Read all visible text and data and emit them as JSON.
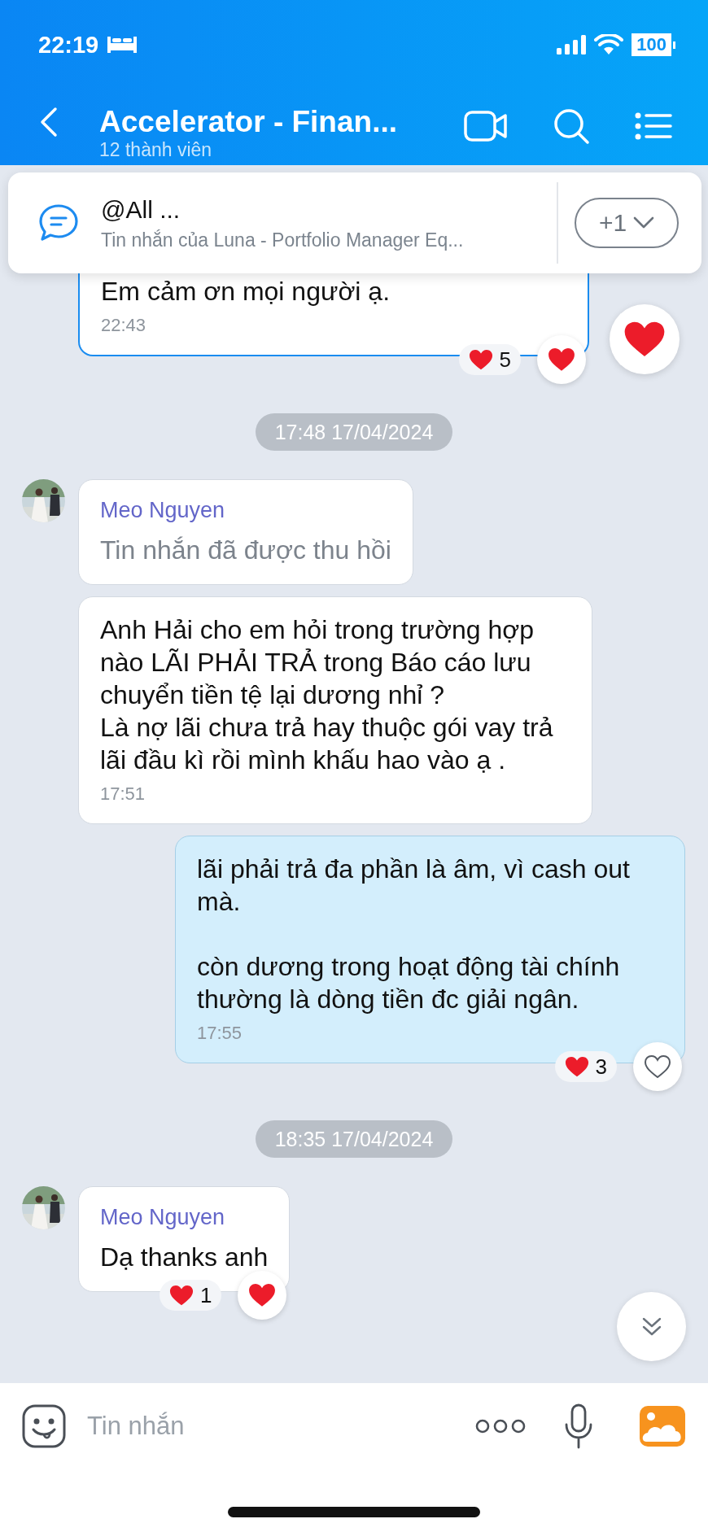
{
  "status_bar": {
    "time": "22:19",
    "battery": "100"
  },
  "header": {
    "title": "Accelerator - Finan...",
    "subtitle": "12 thành viên"
  },
  "pinned": {
    "title": "@All ...",
    "preview": "Tin nhắn của Luna - Portfolio Manager Eq...",
    "more": "+1"
  },
  "items": [
    {
      "kind": "received",
      "text": "Em cảm ơn mọi người ạ.",
      "time": "22:43",
      "recalled": false,
      "highlighted": true,
      "quick_react": true,
      "reactions": {
        "count": "5",
        "reacted": true
      }
    },
    {
      "kind": "date",
      "text": "17:48 17/04/2024"
    },
    {
      "kind": "received",
      "sender": "Meo Nguyen",
      "text": "Tin nhắn đã được thu hồi",
      "recalled": true,
      "highlighted": false,
      "quick_react": false
    },
    {
      "kind": "received",
      "text": "Anh Hải cho em hỏi trong trường hợp nào LÃI PHẢI TRẢ trong Báo cáo lưu chuyển tiền tệ lại dương nhỉ ?\nLà nợ lãi chưa trả hay thuộc gói vay trả lãi đầu kì rồi mình khấu hao vào ạ .",
      "time": "17:51",
      "recalled": false,
      "highlighted": false,
      "quick_react": false
    },
    {
      "kind": "sent",
      "text": "lãi phải trả đa phần là âm, vì cash out mà.\n\ncòn dương trong hoạt động tài chính thường là dòng tiền đc giải ngân.",
      "time": "17:55",
      "recalled": false,
      "highlighted": false,
      "quick_react": false,
      "reactions": {
        "count": "3",
        "reacted": false
      }
    },
    {
      "kind": "date",
      "text": "18:35 17/04/2024"
    },
    {
      "kind": "received",
      "sender": "Meo Nguyen",
      "text": "Dạ thanks anh",
      "recalled": false,
      "highlighted": false,
      "quick_react": false,
      "reactions": {
        "count": "1",
        "reacted": true
      }
    }
  ],
  "composer": {
    "placeholder": "Tin nhắn"
  }
}
